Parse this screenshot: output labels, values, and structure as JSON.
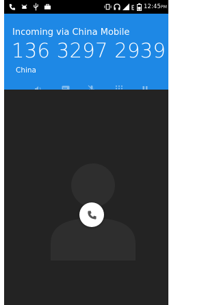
{
  "status_bar": {
    "time": "12:45",
    "ampm": "PM",
    "icons": [
      "missed-call-icon",
      "usb-debug-icon",
      "usb-icon",
      "suitcase-icon",
      "vibrate-icon",
      "headset-icon",
      "signal-icon",
      "network-e-icon",
      "battery-icon"
    ]
  },
  "call": {
    "incoming_label": "Incoming via China Mobile",
    "number": "136 3297 2939",
    "location": "China"
  },
  "controls": [
    "speaker-icon",
    "dialpad-record-icon",
    "mute-icon",
    "keypad-icon",
    "hold-icon"
  ],
  "colors": {
    "header": "#1e88e5",
    "background": "#232323"
  }
}
